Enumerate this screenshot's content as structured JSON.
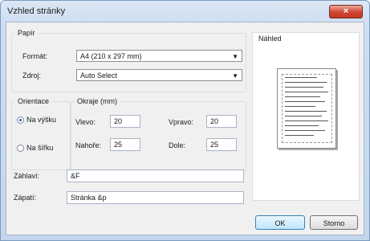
{
  "window": {
    "title": "Vzhled stránky",
    "close_label": "×"
  },
  "paper": {
    "legend": "Papír",
    "format_label": "Formát:",
    "format_value": "A4 (210 x 297 mm)",
    "source_label": "Zdroj:",
    "source_value": "Auto Select"
  },
  "orientation": {
    "legend": "Orientace",
    "portrait_label": "Na výšku",
    "landscape_label": "Na šířku",
    "selected": "portrait"
  },
  "margins": {
    "legend": "Okraje (mm)",
    "left_label": "Vlevo:",
    "left_value": "20",
    "right_label": "Vpravo:",
    "right_value": "20",
    "top_label": "Nahoře:",
    "top_value": "25",
    "bottom_label": "Dole:",
    "bottom_value": "25"
  },
  "header": {
    "label": "Záhlaví:",
    "value": "&F"
  },
  "footer": {
    "label": "Zápatí:",
    "value": "Stránka &p"
  },
  "preview": {
    "legend": "Náhled"
  },
  "buttons": {
    "ok": "OK",
    "cancel": "Storno"
  }
}
